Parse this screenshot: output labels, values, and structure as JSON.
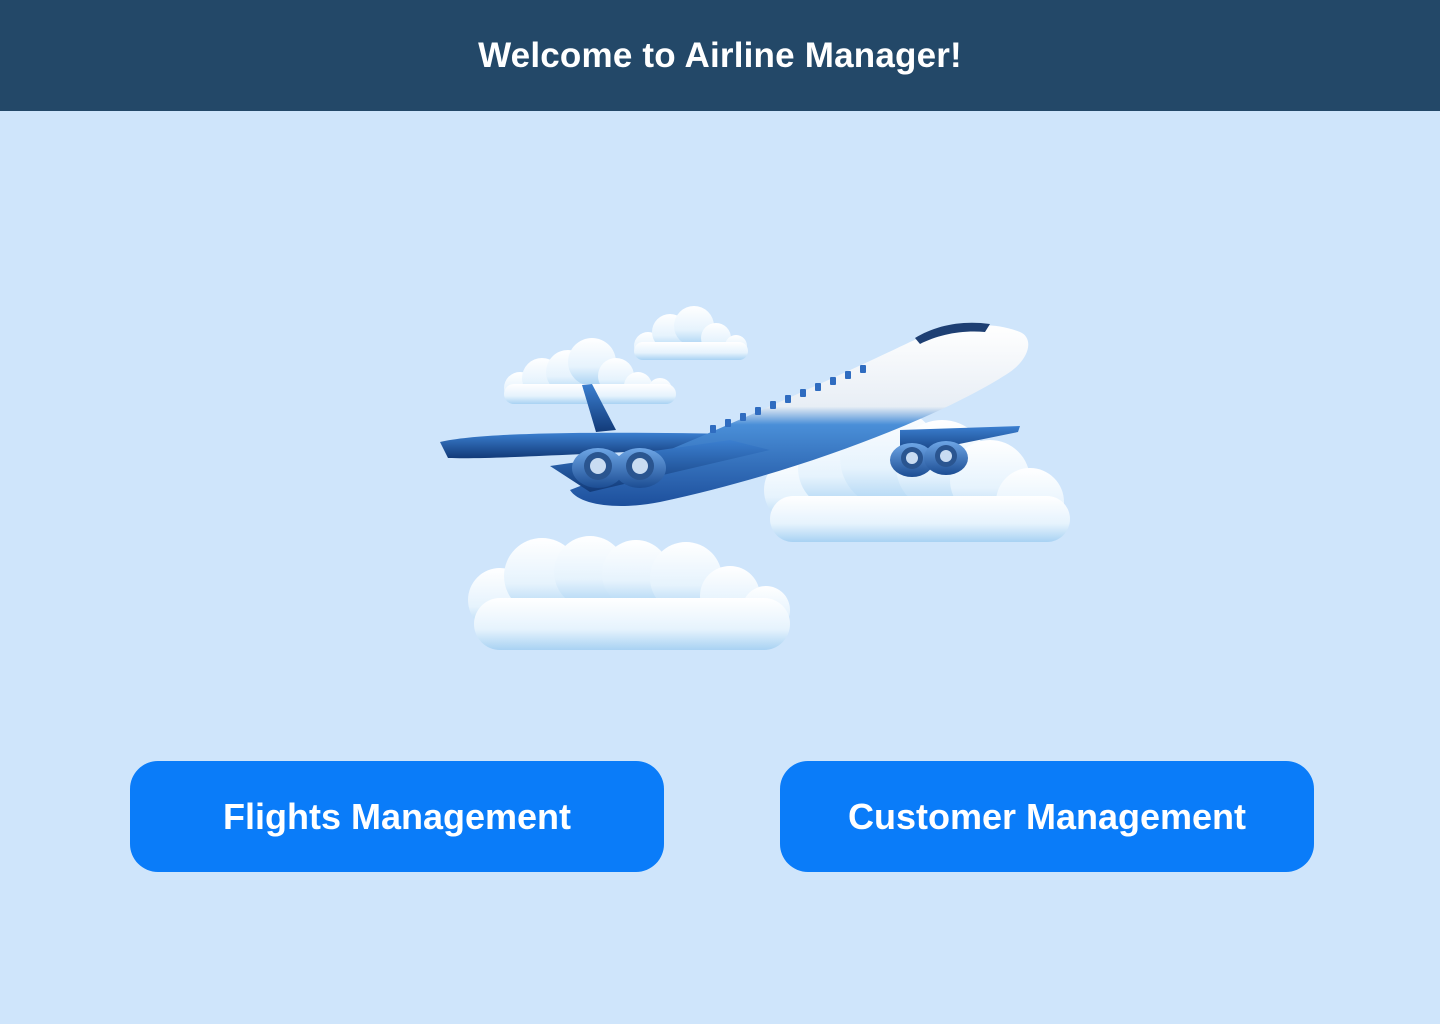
{
  "header": {
    "title": "Welcome to Airline Manager!",
    "background": "#234868"
  },
  "hero": {
    "illustration": "airplane-flying-through-clouds"
  },
  "actions": {
    "flights_label": "Flights Management",
    "customers_label": "Customer Management",
    "button_color": "#0A7CF9"
  },
  "theme": {
    "page_background": "#CFE5FB"
  }
}
